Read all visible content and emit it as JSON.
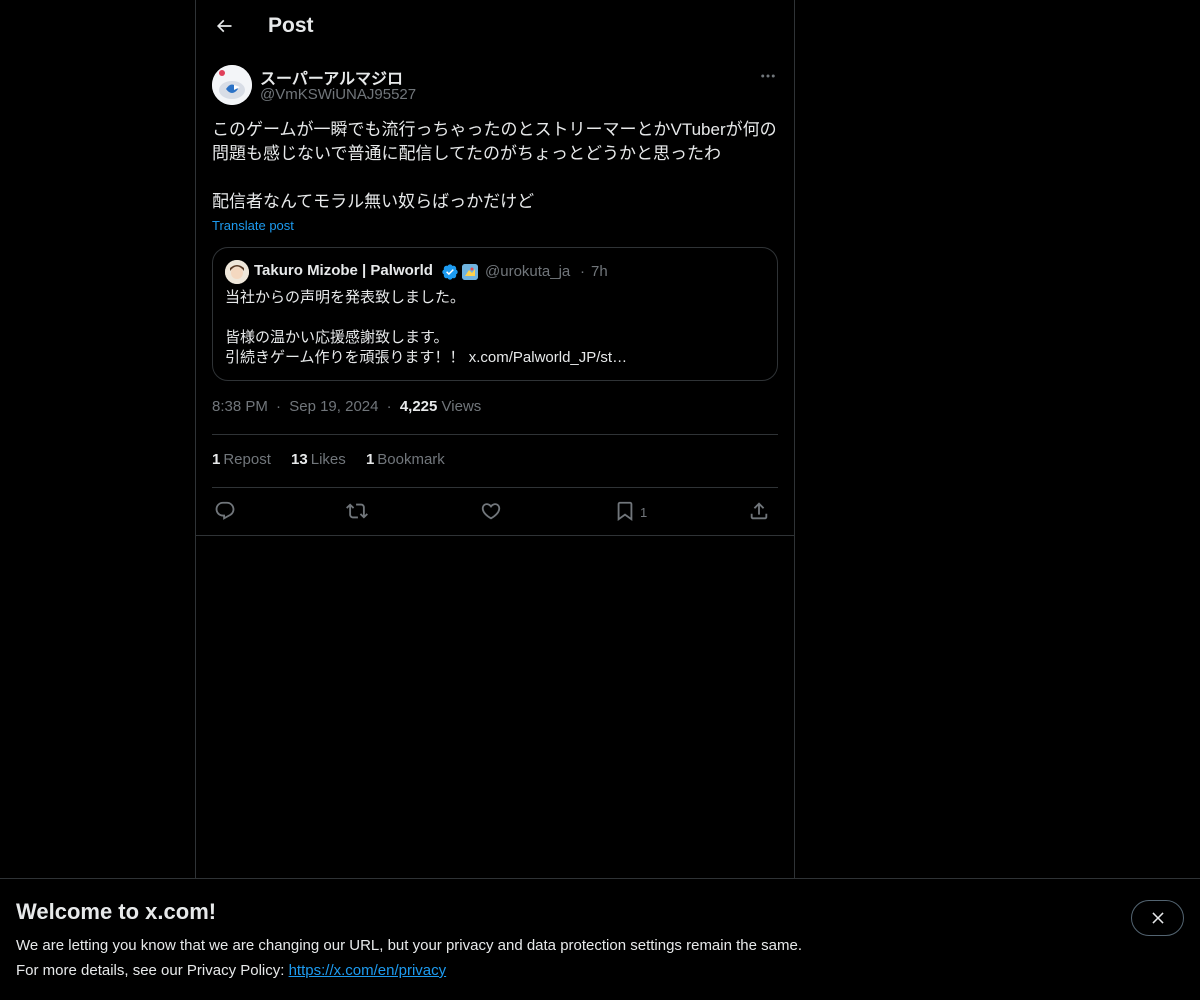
{
  "header": {
    "title": "Post"
  },
  "post": {
    "author_name": "スーパーアルマジロ",
    "author_handle": "@VmKSWiUNAJ95527",
    "text_line1": "このゲームが一瞬でも流行っちゃったのとストリーマーとかVTuberが何の",
    "text_line2": "問題も感じないで普通に配信してたのがちょっとどうかと思ったわ",
    "text_line3": "配信者なんてモラル無い奴らばっかだけど",
    "translate_label": "Translate post",
    "time": "8:38 PM",
    "date": "Sep 19, 2024",
    "views_count": "4,225",
    "views_label": "Views",
    "sep": "·"
  },
  "quote": {
    "author_name": "Takuro Mizobe | Palworld",
    "author_handle": "@urokuta_ja",
    "dot": "·",
    "time": "7h",
    "line1": "当社からの声明を発表致しました。",
    "line2": "皆様の温かい応援感謝致します。",
    "line3": "引続きゲーム作りを頑張ります！！ x.com/Palworld_JP/st…"
  },
  "stats": {
    "reposts_count": "1",
    "reposts_label": "Repost",
    "likes_count": "13",
    "likes_label": "Likes",
    "bookmarks_count": "1",
    "bookmarks_label": "Bookmark"
  },
  "actions": {
    "bookmark_count": "1"
  },
  "icons": {
    "back": "arrow-left-icon",
    "more": "more-horizontal-icon",
    "verified": "verified-badge-icon",
    "reply": "reply-icon",
    "repost": "repost-icon",
    "like": "heart-icon",
    "bookmark": "bookmark-icon",
    "share": "share-icon",
    "close": "close-icon"
  },
  "colors": {
    "accent": "#1d9bf0",
    "background": "#000000",
    "text": "#e7e9ea",
    "muted": "#71767b",
    "border": "#2f3336"
  },
  "banner": {
    "title": "Welcome to x.com!",
    "line1": "We are letting you know that we are changing our URL, but your privacy and data protection settings remain the same.",
    "line2_prefix": "For more details, see our Privacy Policy: ",
    "link": "https://x.com/en/privacy"
  }
}
